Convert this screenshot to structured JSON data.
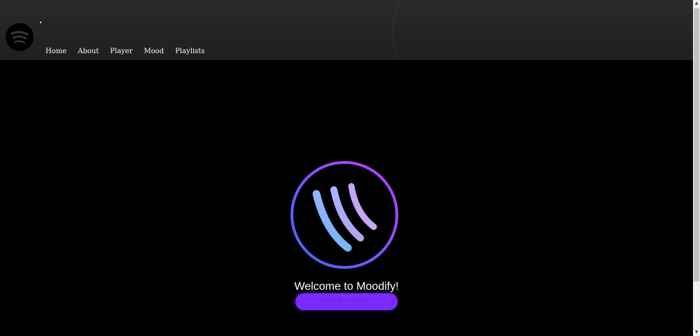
{
  "header": {
    "logo_icon": "spotify-icon",
    "nav": [
      {
        "label": "Home"
      },
      {
        "label": "About"
      },
      {
        "label": "Player"
      },
      {
        "label": "Mood"
      },
      {
        "label": "Playlists"
      }
    ]
  },
  "hero": {
    "logo_icon": "moodify-logo-icon",
    "welcome_text": "Welcome to Moodify!",
    "cta_label": "LOGIN WITH SPOTIFY",
    "colors": {
      "background": "#000000",
      "ring_start": "#3b6cff",
      "ring_end": "#c13bff",
      "button": "#7a2bff"
    }
  }
}
